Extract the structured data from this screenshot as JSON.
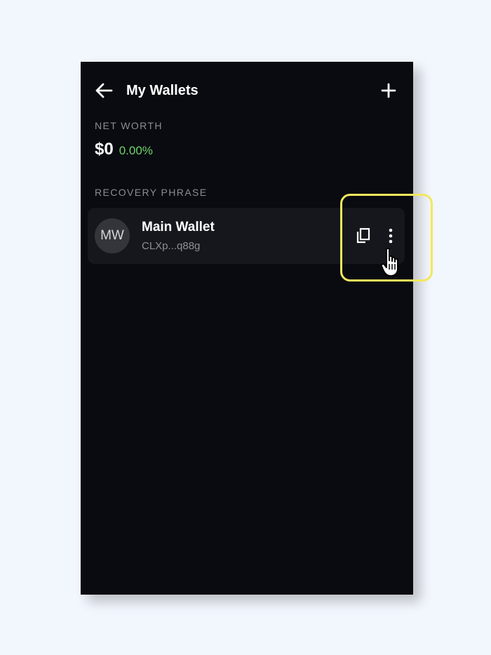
{
  "header": {
    "title": "My Wallets",
    "back_icon": "arrow-left-icon",
    "add_icon": "plus-icon"
  },
  "net_worth": {
    "label": "NET WORTH",
    "value": "$0",
    "change": "0.00%"
  },
  "recovery_phrase": {
    "label": "RECOVERY PHRASE",
    "wallets": [
      {
        "initials": "MW",
        "name": "Main Wallet",
        "address": "CLXp...q88g",
        "copy_icon": "copy-icon",
        "more_icon": "more-vertical-icon"
      }
    ]
  },
  "colors": {
    "page_background": "#f2f6fd",
    "panel_background": "#090b10",
    "card_background": "#15171c",
    "positive_change": "#6fd36a",
    "highlight": "#f2e85c"
  }
}
